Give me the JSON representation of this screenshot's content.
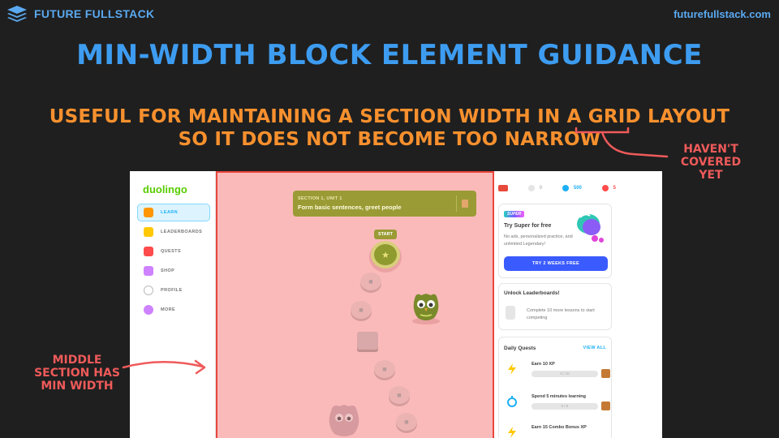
{
  "header": {
    "brand": "FUTURE FULLSTACK",
    "site_url": "futurefullstack.com"
  },
  "slide": {
    "title": "MIN-WIDTH BLOCK ELEMENT GUIDANCE",
    "subtitle_line1": "USEFUL FOR MAINTAINING A SECTION WIDTH IN A GRID LAYOUT",
    "subtitle_line2": "SO IT DOES NOT BECOME TOO NARROW",
    "annotation_right": "HAVEN'T COVERED YET",
    "annotation_left": "MIDDLE SECTION HAS MIN WIDTH"
  },
  "colors": {
    "title": "#3d9cf0",
    "subtitle": "#f7902e",
    "annotation": "#ef5a5a",
    "background": "#1f1f1f",
    "middle_highlight": "#fbbaba"
  },
  "app": {
    "logo": "duolingo",
    "nav": [
      {
        "label": "LEARN",
        "icon": "home-icon",
        "active": true,
        "color": "#ff9600"
      },
      {
        "label": "LEADERBOARDS",
        "icon": "shield-icon",
        "active": false,
        "color": "#ffc800"
      },
      {
        "label": "QUESTS",
        "icon": "chest-icon",
        "active": false,
        "color": "#ff4b4b"
      },
      {
        "label": "SHOP",
        "icon": "shop-icon",
        "active": false,
        "color": "#ce82ff"
      },
      {
        "label": "PROFILE",
        "icon": "profile-icon",
        "active": false,
        "color": "#e5e5e5"
      },
      {
        "label": "MORE",
        "icon": "more-icon",
        "active": false,
        "color": "#ce82ff"
      }
    ],
    "unit": {
      "section": "SECTION 1, UNIT 1",
      "description": "Form basic sentences, greet people"
    },
    "start_label": "START",
    "stats": {
      "streak": "0",
      "gems": "500",
      "hearts": "5"
    },
    "super_card": {
      "badge": "SUPER",
      "title": "Try Super for free",
      "description": "No ads, personalized practice, and unlimited Legendary!",
      "button": "TRY 2 WEEKS FREE"
    },
    "leaderboard_card": {
      "title": "Unlock Leaderboards!",
      "text": "Complete 10 more lessons to start competing"
    },
    "quests_card": {
      "title": "Daily Quests",
      "view_all": "VIEW ALL",
      "items": [
        {
          "title": "Earn 10 XP",
          "progress": "0 / 10",
          "icon": "lightning-icon"
        },
        {
          "title": "Spend 5 minutes learning",
          "progress": "0 / 5",
          "icon": "timer-icon"
        },
        {
          "title": "Earn 15 Combo Bonus XP",
          "progress": "",
          "icon": "lightning-icon"
        }
      ]
    }
  }
}
